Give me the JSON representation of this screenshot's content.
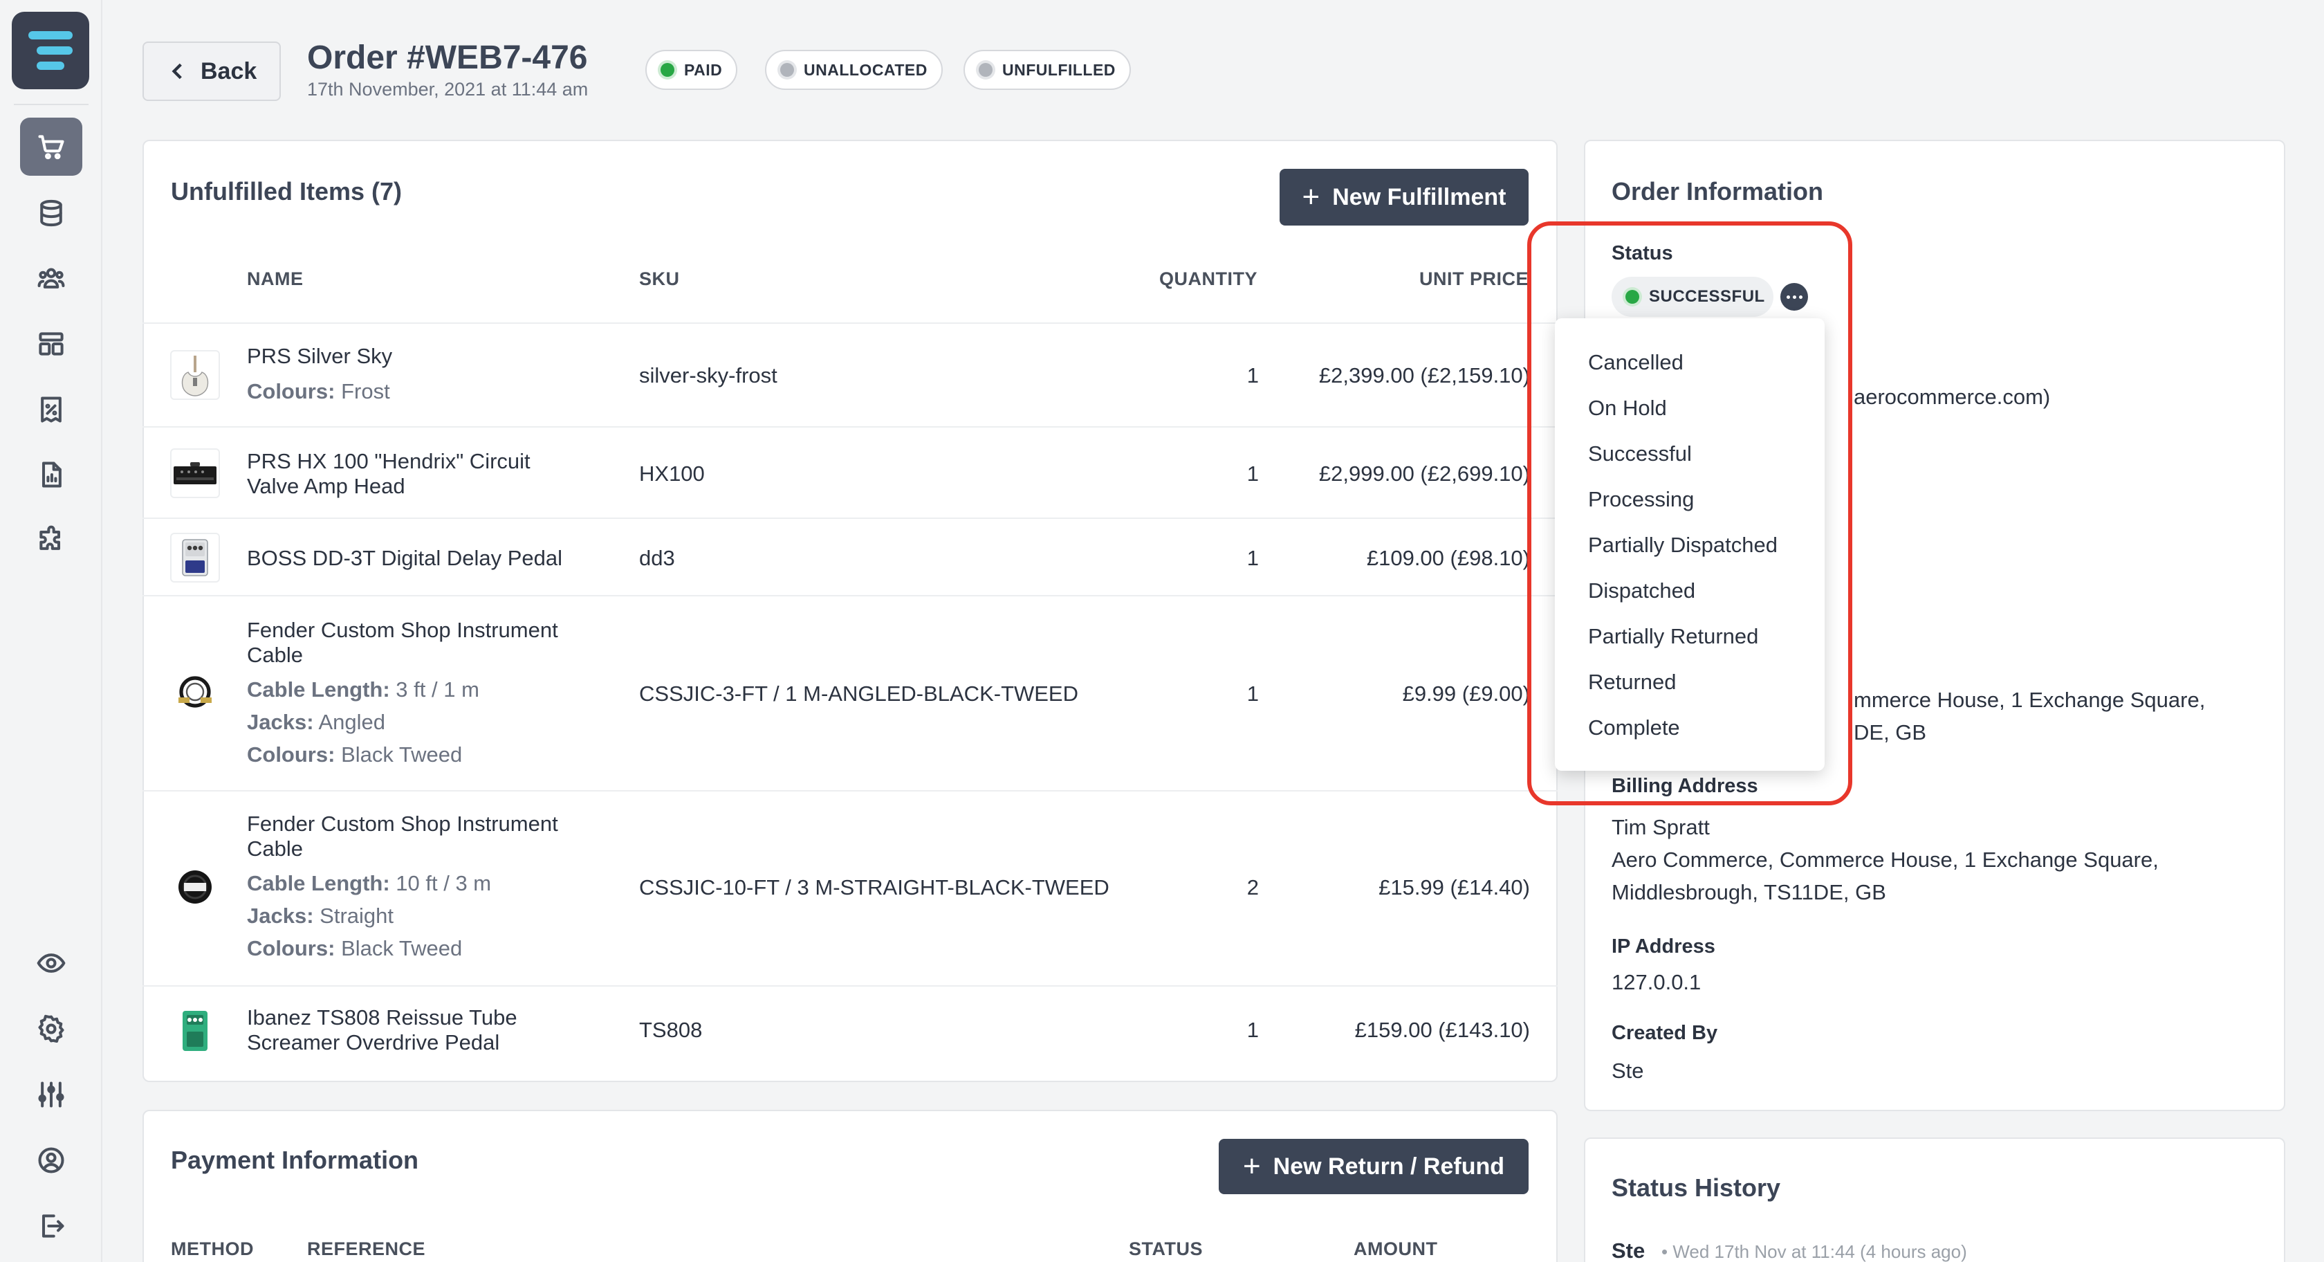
{
  "nav": {
    "items": [
      "orders",
      "products",
      "customers",
      "layout",
      "promotions",
      "reports",
      "extensions"
    ],
    "bottom_items": [
      "preview",
      "settings",
      "configuration",
      "account",
      "logout"
    ]
  },
  "header": {
    "back_label": "Back",
    "title": "Order #WEB7-476",
    "date": "17th November, 2021 at 11:44 am",
    "badges": [
      {
        "label": "PAID",
        "color": "#28a745"
      },
      {
        "label": "UNALLOCATED",
        "color": "#b0b4bb"
      },
      {
        "label": "UNFULFILLED",
        "color": "#b0b4bb"
      }
    ]
  },
  "unfulfilled": {
    "title": "Unfulfilled Items (7)",
    "new_fulfillment_label": "New Fulfillment",
    "columns": {
      "name": "NAME",
      "sku": "SKU",
      "quantity": "QUANTITY",
      "unit_price": "UNIT PRICE"
    },
    "items": [
      {
        "name_lines": [
          "PRS Silver Sky"
        ],
        "attrs": [
          {
            "k": "Colours:",
            "v": "Frost"
          }
        ],
        "sku": "silver-sky-frost",
        "qty": "1",
        "price": "£2,399.00 (£2,159.10)"
      },
      {
        "name_lines": [
          "PRS HX 100 \"Hendrix\" Circuit",
          "Valve Amp Head"
        ],
        "attrs": [],
        "sku": "HX100",
        "qty": "1",
        "price": "£2,999.00 (£2,699.10)"
      },
      {
        "name_lines": [
          "BOSS DD-3T Digital Delay Pedal"
        ],
        "attrs": [],
        "sku": "dd3",
        "qty": "1",
        "price": "£109.00 (£98.10)"
      },
      {
        "name_lines": [
          "Fender Custom Shop Instrument",
          "Cable"
        ],
        "attrs": [
          {
            "k": "Cable Length:",
            "v": "3 ft / 1 m"
          },
          {
            "k": "Jacks:",
            "v": "Angled"
          },
          {
            "k": "Colours:",
            "v": "Black Tweed"
          }
        ],
        "sku": "CSSJIC-3-FT / 1 M-ANGLED-BLACK-TWEED",
        "qty": "1",
        "price": "£9.99 (£9.00)"
      },
      {
        "name_lines": [
          "Fender Custom Shop Instrument",
          "Cable"
        ],
        "attrs": [
          {
            "k": "Cable Length:",
            "v": "10 ft / 3 m"
          },
          {
            "k": "Jacks:",
            "v": "Straight"
          },
          {
            "k": "Colours:",
            "v": "Black Tweed"
          }
        ],
        "sku": "CSSJIC-10-FT / 3 M-STRAIGHT-BLACK-TWEED",
        "qty": "2",
        "price": "£15.99 (£14.40)"
      },
      {
        "name_lines": [
          "Ibanez TS808 Reissue Tube",
          "Screamer Overdrive Pedal"
        ],
        "attrs": [],
        "sku": "TS808",
        "qty": "1",
        "price": "£159.00 (£143.10)"
      }
    ]
  },
  "payment": {
    "title": "Payment Information",
    "new_return_label": "New Return / Refund",
    "columns": {
      "method": "METHOD",
      "reference": "REFERENCE",
      "status": "STATUS",
      "amount": "AMOUNT"
    }
  },
  "order_info": {
    "title": "Order Information",
    "status_label": "Status",
    "status_value": "SUCCESSFUL",
    "status_color": "#28a745",
    "email_tail": "aerocommerce.com)",
    "shipping_partial": [
      "mmerce House, 1 Exchange Square,",
      "DE, GB"
    ],
    "billing_label": "Billing Address",
    "billing_lines": [
      "Tim Spratt",
      "Aero Commerce, Commerce House, 1 Exchange Square,",
      "Middlesbrough, TS11DE, GB"
    ],
    "ip_label": "IP Address",
    "ip_value": "127.0.0.1",
    "created_by_label": "Created By",
    "created_by_value": "Ste"
  },
  "status_dropdown": {
    "options": [
      "Cancelled",
      "On Hold",
      "Successful",
      "Processing",
      "Partially Dispatched",
      "Dispatched",
      "Partially Returned",
      "Returned",
      "Complete"
    ],
    "highlight_color": "#e8372b"
  },
  "status_history": {
    "title": "Status History",
    "entries": [
      {
        "user": "Ste",
        "meta": "• Wed 17th Nov at 11:44 (4 hours ago)"
      }
    ]
  }
}
